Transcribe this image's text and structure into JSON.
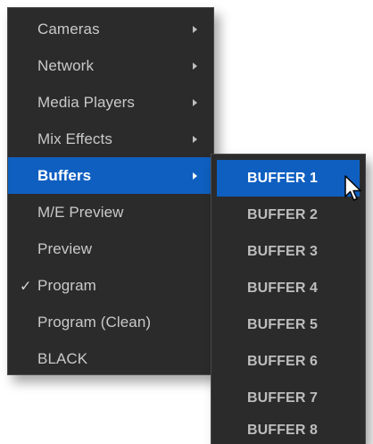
{
  "main_menu": {
    "items": [
      {
        "label": "Cameras",
        "submenu": true
      },
      {
        "label": "Network",
        "submenu": true
      },
      {
        "label": "Media Players",
        "submenu": true
      },
      {
        "label": "Mix Effects",
        "submenu": true
      },
      {
        "label": "Buffers",
        "submenu": true,
        "active": true
      },
      {
        "label": "M/E Preview"
      },
      {
        "label": "Preview"
      },
      {
        "label": "Program",
        "checked": true
      },
      {
        "label": "Program (Clean)"
      },
      {
        "label": "BLACK"
      }
    ],
    "check_glyph": "✓"
  },
  "sub_menu": {
    "items": [
      {
        "label": "BUFFER 1",
        "active": true
      },
      {
        "label": "BUFFER 2"
      },
      {
        "label": "BUFFER 3"
      },
      {
        "label": "BUFFER 4"
      },
      {
        "label": "BUFFER 5"
      },
      {
        "label": "BUFFER 6"
      },
      {
        "label": "BUFFER 7"
      },
      {
        "label": "BUFFER 8"
      }
    ]
  },
  "colors": {
    "menu_background": "#2b2b2b",
    "highlight": "#0f5fc0",
    "text": "#c9c9c9"
  }
}
